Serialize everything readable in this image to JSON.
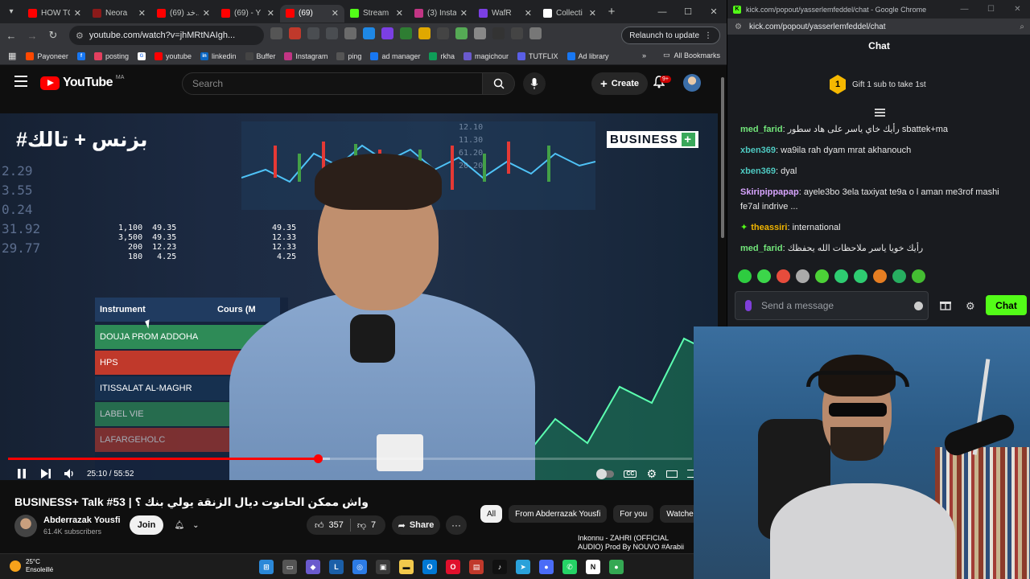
{
  "left_browser": {
    "tabs": [
      {
        "title": "HOW TO",
        "color": "#ff0000"
      },
      {
        "title": "Neora",
        "color": "#8b1a1a"
      },
      {
        "title": "(69) خد...",
        "color": "#ff0000"
      },
      {
        "title": "(69) - Y",
        "color": "#ff0000"
      },
      {
        "title": "(69)",
        "color": "#ff0000",
        "active": true
      },
      {
        "title": "Stream",
        "color": "#53fc18"
      },
      {
        "title": "(3) Insta",
        "color": "#c13584"
      },
      {
        "title": "WafR",
        "color": "#7b3fe4"
      },
      {
        "title": "Collecti",
        "color": "#ffffff"
      }
    ],
    "url": "youtube.com/watch?v=jhMRtNAIgh...",
    "relaunch_label": "Relaunch to update",
    "bookmarks": [
      {
        "label": "Payoneer",
        "color": "#ff4800"
      },
      {
        "label": "",
        "color": "#1877f2",
        "icon": "f"
      },
      {
        "label": "posting",
        "color": "#e4405f"
      },
      {
        "label": "",
        "color": "#ffffff",
        "icon": "G"
      },
      {
        "label": "youtube",
        "color": "#ff0000"
      },
      {
        "label": "linkedin",
        "color": "#0a66c2",
        "icon": "in"
      },
      {
        "label": "Buffer",
        "color": "#444444"
      },
      {
        "label": "Instagram",
        "color": "#c13584"
      },
      {
        "label": "ping",
        "color": "#555555"
      },
      {
        "label": "ad manager",
        "color": "#1877f2"
      },
      {
        "label": "rkha",
        "color": "#0f9d58"
      },
      {
        "label": "magichour",
        "color": "#6a5acd"
      },
      {
        "label": "TUTFLIX",
        "color": "#5a5fe6"
      },
      {
        "label": "Ad library",
        "color": "#1877f2"
      }
    ],
    "all_bookmarks": "All Bookmarks"
  },
  "youtube": {
    "logo_text": "YouTube",
    "region": "MA",
    "search_placeholder": "Search",
    "create_label": "Create",
    "notif_count": "9+",
    "video": {
      "overlay_title": "#بزنس + تالك",
      "brand": "BUSINESS",
      "brand_plus": "+",
      "table_header_1": "Instrument",
      "table_header_2": "Cours (M",
      "table_rows": [
        "DOUJA PROM ADDOHA",
        "HPS",
        "ITISSALAT AL-MAGHR",
        "LABEL VIE",
        "LAFARGEHOLC"
      ],
      "ticker_left": "2.29\n3.55\n0.24\n31.92\n29.77",
      "ticker_mid": "12.10\n11.30\n61.20\n20.20",
      "ticker_data": "1,100  49.35\n3,500  49.35\n  200  12.23\n  180   4.25",
      "ticker_data2": "49.35\n12.33\n12.33\n 4.25",
      "progress": 0.453,
      "buffered": 0.47,
      "time": "25:10 / 55:52"
    },
    "title": "BUSINESS+ Talk #53 | واش ممكن الحانوت ديال الزنقة يولي بنك ؟",
    "channel": "Abderrazak Yousfi",
    "subs": "61.4K subscribers",
    "join": "Join",
    "likes": "357",
    "dislikes": "7",
    "share": "Share",
    "chips": [
      "All",
      "From Abderrazak Yousfi",
      "For you",
      "Watched"
    ],
    "rec_title": "Inkonnu - ZAHRI (OFFICIAL AUDIO) Prod By NOUVO #Arabii"
  },
  "kick": {
    "window_title": "kick.com/popout/yasserlemfeddel/chat - Google Chrome",
    "url": "kick.com/popout/yasserlemfeddel/chat",
    "chat_title": "Chat",
    "gift_rank": "1",
    "gift_text": "Gift 1 sub to take 1st",
    "messages": [
      {
        "user": "med_farid",
        "color": "#72e67a",
        "text": "رأيك خاي ياسر على هاد سطور sbattek+ma"
      },
      {
        "user": "xben369",
        "color": "#4ec9c1",
        "text": "wa9ila rah dyam mrat akhanouch"
      },
      {
        "user": "xben369",
        "color": "#4ec9c1",
        "text": "dyal"
      },
      {
        "user": "Skiripippapap",
        "color": "#d8a5ff",
        "text": "ayele3bo 3ela taxiyat te9a o l aman me3rof mashi fe7al indrive ..."
      },
      {
        "user": "theassiri",
        "color": "#f0b400",
        "text": "international",
        "badge": true
      },
      {
        "user": "med_farid",
        "color": "#72e67a",
        "text": "رأيك خويا ياسر ملاحظات الله يحفظك"
      }
    ],
    "emote_colors": [
      "#2ecc40",
      "#3cd64a",
      "#e74c3c",
      "#aaaaaa",
      "#4cd137",
      "#2ecc71",
      "#2ecc71",
      "#e67e22",
      "#27ae60",
      "#44bd32"
    ],
    "input_placeholder": "Send a message",
    "send_label": "Chat"
  },
  "taskbar": {
    "temp": "25°C",
    "weather": "Ensoleillé",
    "icons": [
      {
        "name": "windows-start-icon",
        "color": "#2b88d8",
        "glyph": "⊞"
      },
      {
        "name": "task-view-icon",
        "color": "#555555",
        "glyph": "▭"
      },
      {
        "name": "copilot-icon",
        "color": "#6a5acd",
        "glyph": "◆"
      },
      {
        "name": "app-icon",
        "color": "#1b5fa8",
        "glyph": "L"
      },
      {
        "name": "vpn-icon",
        "color": "#2c7be5",
        "glyph": "◎"
      },
      {
        "name": "terminal-icon",
        "color": "#3a3a3a",
        "glyph": "▣"
      },
      {
        "name": "file-explorer-icon",
        "color": "#f2c94c",
        "glyph": "▬"
      },
      {
        "name": "outlook-icon",
        "color": "#0078d4",
        "glyph": "O"
      },
      {
        "name": "opera-icon",
        "color": "#e0102c",
        "glyph": "O"
      },
      {
        "name": "app2-icon",
        "color": "#c0392b",
        "glyph": "▤"
      },
      {
        "name": "tiktok-icon",
        "color": "#111111",
        "glyph": "♪"
      },
      {
        "name": "telegram-icon",
        "color": "#2aa1da",
        "glyph": "➤"
      },
      {
        "name": "app3-icon",
        "color": "#4a6cf7",
        "glyph": "●"
      },
      {
        "name": "whatsapp-icon",
        "color": "#25d366",
        "glyph": "✆"
      },
      {
        "name": "notion-icon",
        "color": "#ffffff",
        "glyph": "N"
      },
      {
        "name": "chrome-icon",
        "color": "#34a853",
        "glyph": "●"
      }
    ]
  }
}
